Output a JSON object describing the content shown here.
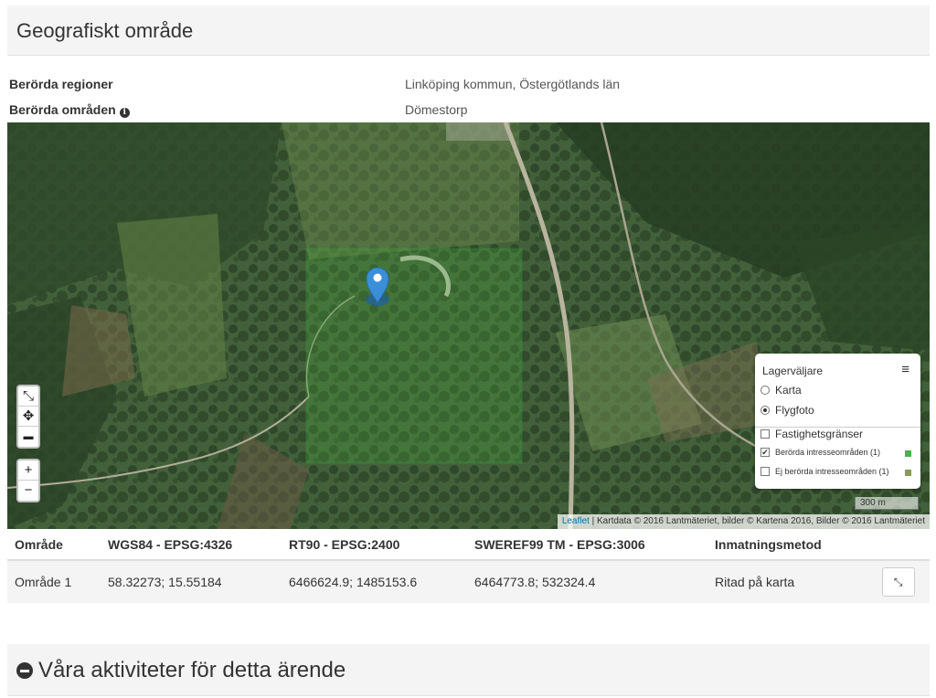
{
  "geo": {
    "heading": "Geografiskt område",
    "regions_label": "Berörda regioner",
    "regions_value": "Linköping kommun, Östergötlands län",
    "areas_label": "Berörda områden",
    "areas_value": "Dömestorp",
    "info_icon": "info-icon"
  },
  "map": {
    "controls": {
      "collapse_icon": "collapse-icon",
      "locate_icon": "crosshair-icon",
      "measure_icon": "ruler-icon",
      "zoom_in": "+",
      "zoom_out": "−"
    },
    "layers": {
      "title": "Lagerväljare",
      "base": [
        {
          "label": "Karta",
          "selected": false
        },
        {
          "label": "Flygfoto",
          "selected": true
        }
      ],
      "overlays": [
        {
          "label": "Fastighetsgränser",
          "checked": false
        },
        {
          "label": "Berörda intresseområden (1)",
          "checked": true,
          "color": "#4caf50"
        },
        {
          "label": "Ej berörda intresseområden (1)",
          "checked": false,
          "color": "#8a9a5b"
        }
      ]
    },
    "scale": "300 m",
    "attribution_link": "Leaflet",
    "attribution_text": "| Kartdata © 2016 Lantmäteriet, bilder © Kartena 2016, Bilder © 2016 Lantmäteriet",
    "area_color": "#3fa83f",
    "marker_color": "#3a8fd8"
  },
  "table": {
    "headers": [
      "Område",
      "WGS84 - EPSG:4326",
      "RT90 - EPSG:2400",
      "SWEREF99 TM - EPSG:3006",
      "Inmatningsmetod"
    ],
    "rows": [
      {
        "area": "Område 1",
        "wgs84": "58.32273; 15.55184",
        "rt90": "6466624.9; 1485153.6",
        "sweref": "6464773.8; 532324.4",
        "method": "Ritad på karta",
        "action_icon": "zoom-to-icon"
      }
    ]
  },
  "activities": {
    "heading": "Våra aktiviteter för detta ärende",
    "icon": "minus-circle-icon"
  }
}
